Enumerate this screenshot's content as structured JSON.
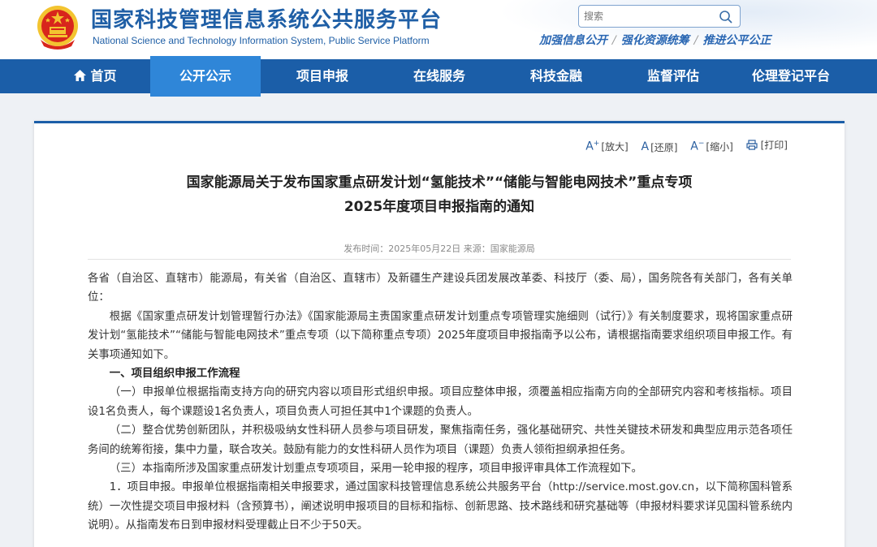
{
  "header": {
    "title_cn": "国家科技管理信息系统公共服务平台",
    "title_en": "National Science and Technology Information System, Public Service Platform",
    "search_placeholder": "搜索",
    "slogan": [
      "加强信息公开",
      "强化资源统筹",
      "推进公平公正"
    ],
    "slogan_sep": "/"
  },
  "nav": {
    "items": [
      {
        "label": "首页"
      },
      {
        "label": "公开公示"
      },
      {
        "label": "项目申报"
      },
      {
        "label": "在线服务"
      },
      {
        "label": "科技金融"
      },
      {
        "label": "监督评估"
      },
      {
        "label": "伦理登记平台"
      }
    ],
    "active_index": 1
  },
  "tools": {
    "enlarge": "[放大]",
    "reset": "[还原]",
    "shrink": "[缩小]",
    "print": "[打印]"
  },
  "article": {
    "title_line1": "国家能源局关于发布国家重点研发计划“氢能技术”“储能与智能电网技术”重点专项",
    "title_line2": "2025年度项目申报指南的通知",
    "meta": "发布时间：2025年05月22日 来源：国家能源局",
    "paragraphs": [
      "各省（自治区、直辖市）能源局，有关省（自治区、直辖市）及新疆生产建设兵团发展改革委、科技厅（委、局），国务院各有关部门，各有关单位：",
      "根据《国家重点研发计划管理暂行办法》《国家能源局主责国家重点研发计划重点专项管理实施细则（试行）》有关制度要求，现将国家重点研发计划“氢能技术”“储能与智能电网技术”重点专项（以下简称重点专项）2025年度项目申报指南予以公布，请根据指南要求组织项目申报工作。有关事项通知如下。",
      "一、项目组织申报工作流程",
      "（一）申报单位根据指南支持方向的研究内容以项目形式组织申报。项目应整体申报，须覆盖相应指南方向的全部研究内容和考核指标。项目设1名负责人，每个课题设1名负责人，项目负责人可担任其中1个课题的负责人。",
      "（二）整合优势创新团队，并积极吸纳女性科研人员参与项目研发，聚焦指南任务，强化基础研究、共性关键技术研发和典型应用示范各项任务间的统筹衔接，集中力量，联合攻关。鼓励有能力的女性科研人员作为项目（课题）负责人领衔担纲承担任务。",
      "（三）本指南所涉及国家重点研发计划重点专项项目，采用一轮申报的程序，项目申报评审具体工作流程如下。",
      "1．项目申报。申报单位根据指南相关申报要求，通过国家科技管理信息系统公共服务平台（http://service.most.gov.cn，以下简称国科管系统）一次性提交项目申报材料（含预算书），阐述说明申报项目的目标和指标、创新思路、技术路线和研究基础等（申报材料要求详见国科管系统内说明）。从指南发布日到申报材料受理截止日不少于50天。"
    ]
  },
  "colors": {
    "brand_blue": "#1b5ea8",
    "nav_active": "#2f86d8",
    "emblem_red": "#d8261c",
    "emblem_gold": "#f3c430"
  }
}
